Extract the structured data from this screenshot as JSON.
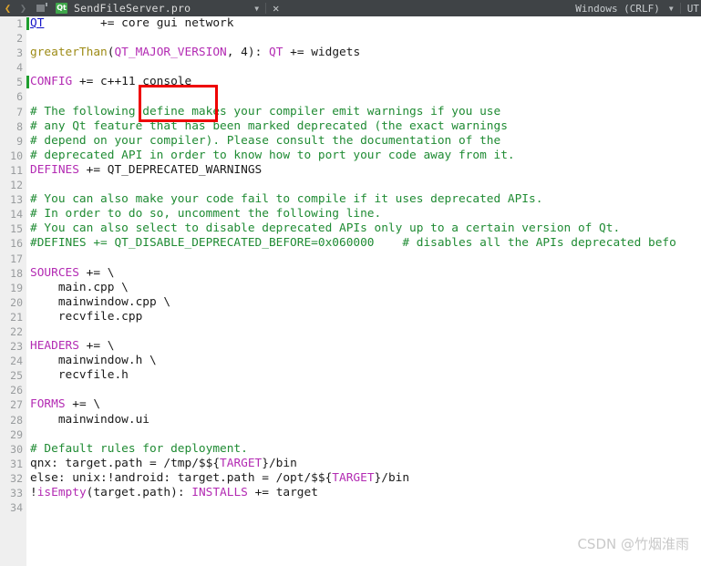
{
  "titlebar": {
    "back_icon": "chevron-left-icon",
    "forward_icon": "chevron-right-icon",
    "split_icon": "split-window-icon",
    "app_icon_label": "Qt",
    "document_title": "SendFileServer.pro",
    "caret_icon": "chevron-down-icon",
    "close_icon": "close-icon",
    "eol_mode": "Windows (CRLF)",
    "eol_caret_icon": "chevron-down-icon",
    "encoding": "UT"
  },
  "editor": {
    "redbox_target": "console",
    "lines": [
      {
        "n": "1",
        "modified": true,
        "tokens": [
          {
            "t": "QT",
            "c": "lnk"
          },
          {
            "t": "        += core gui network",
            "c": "plain"
          }
        ]
      },
      {
        "n": "2",
        "modified": false,
        "tokens": []
      },
      {
        "n": "3",
        "modified": false,
        "tokens": [
          {
            "t": "greaterThan",
            "c": "fn"
          },
          {
            "t": "(",
            "c": "plain"
          },
          {
            "t": "QT_MAJOR_VERSION",
            "c": "var"
          },
          {
            "t": ", 4): ",
            "c": "plain"
          },
          {
            "t": "QT",
            "c": "var"
          },
          {
            "t": " += widgets",
            "c": "plain"
          }
        ]
      },
      {
        "n": "4",
        "modified": false,
        "tokens": []
      },
      {
        "n": "5",
        "modified": true,
        "tokens": [
          {
            "t": "CONFIG",
            "c": "var"
          },
          {
            "t": " += c++11 console",
            "c": "plain"
          }
        ]
      },
      {
        "n": "6",
        "modified": false,
        "tokens": []
      },
      {
        "n": "7",
        "modified": false,
        "tokens": [
          {
            "t": "# The following define makes your compiler emit warnings if you use",
            "c": "cmt"
          }
        ]
      },
      {
        "n": "8",
        "modified": false,
        "tokens": [
          {
            "t": "# any Qt feature that has been marked deprecated (the exact warnings",
            "c": "cmt"
          }
        ]
      },
      {
        "n": "9",
        "modified": false,
        "tokens": [
          {
            "t": "# depend on your compiler). Please consult the documentation of the",
            "c": "cmt"
          }
        ]
      },
      {
        "n": "10",
        "modified": false,
        "tokens": [
          {
            "t": "# deprecated API in order to know how to port your code away from it.",
            "c": "cmt"
          }
        ]
      },
      {
        "n": "11",
        "modified": false,
        "tokens": [
          {
            "t": "DEFINES",
            "c": "var"
          },
          {
            "t": " += QT_DEPRECATED_WARNINGS",
            "c": "plain"
          }
        ]
      },
      {
        "n": "12",
        "modified": false,
        "tokens": []
      },
      {
        "n": "13",
        "modified": false,
        "tokens": [
          {
            "t": "# You can also make your code fail to compile if it uses deprecated APIs.",
            "c": "cmt"
          }
        ]
      },
      {
        "n": "14",
        "modified": false,
        "tokens": [
          {
            "t": "# In order to do so, uncomment the following line.",
            "c": "cmt"
          }
        ]
      },
      {
        "n": "15",
        "modified": false,
        "tokens": [
          {
            "t": "# You can also select to disable deprecated APIs only up to a certain version of Qt.",
            "c": "cmt"
          }
        ]
      },
      {
        "n": "16",
        "modified": false,
        "tokens": [
          {
            "t": "#DEFINES += QT_DISABLE_DEPRECATED_BEFORE=0x060000    # disables all the APIs deprecated befo",
            "c": "cmt"
          }
        ]
      },
      {
        "n": "17",
        "modified": false,
        "tokens": []
      },
      {
        "n": "18",
        "modified": false,
        "tokens": [
          {
            "t": "SOURCES",
            "c": "var"
          },
          {
            "t": " += \\",
            "c": "plain"
          }
        ]
      },
      {
        "n": "19",
        "modified": false,
        "tokens": [
          {
            "t": "    main.cpp \\",
            "c": "plain"
          }
        ]
      },
      {
        "n": "20",
        "modified": false,
        "tokens": [
          {
            "t": "    mainwindow.cpp \\",
            "c": "plain"
          }
        ]
      },
      {
        "n": "21",
        "modified": false,
        "tokens": [
          {
            "t": "    recvfile.cpp",
            "c": "plain"
          }
        ]
      },
      {
        "n": "22",
        "modified": false,
        "tokens": []
      },
      {
        "n": "23",
        "modified": false,
        "tokens": [
          {
            "t": "HEADERS",
            "c": "var"
          },
          {
            "t": " += \\",
            "c": "plain"
          }
        ]
      },
      {
        "n": "24",
        "modified": false,
        "tokens": [
          {
            "t": "    mainwindow.h \\",
            "c": "plain"
          }
        ]
      },
      {
        "n": "25",
        "modified": false,
        "tokens": [
          {
            "t": "    recvfile.h",
            "c": "plain"
          }
        ]
      },
      {
        "n": "26",
        "modified": false,
        "tokens": []
      },
      {
        "n": "27",
        "modified": false,
        "tokens": [
          {
            "t": "FORMS",
            "c": "var"
          },
          {
            "t": " += \\",
            "c": "plain"
          }
        ]
      },
      {
        "n": "28",
        "modified": false,
        "tokens": [
          {
            "t": "    mainwindow.ui",
            "c": "plain"
          }
        ]
      },
      {
        "n": "29",
        "modified": false,
        "tokens": []
      },
      {
        "n": "30",
        "modified": false,
        "tokens": [
          {
            "t": "# Default rules for deployment.",
            "c": "cmt"
          }
        ]
      },
      {
        "n": "31",
        "modified": false,
        "tokens": [
          {
            "t": "qnx: target.path = /tmp/$${",
            "c": "plain"
          },
          {
            "t": "TARGET",
            "c": "var"
          },
          {
            "t": "}/bin",
            "c": "plain"
          }
        ]
      },
      {
        "n": "32",
        "modified": false,
        "tokens": [
          {
            "t": "else: unix:!android: target.path = /opt/$${",
            "c": "plain"
          },
          {
            "t": "TARGET",
            "c": "var"
          },
          {
            "t": "}/bin",
            "c": "plain"
          }
        ]
      },
      {
        "n": "33",
        "modified": false,
        "tokens": [
          {
            "t": "!",
            "c": "plain"
          },
          {
            "t": "isEmpty",
            "c": "var"
          },
          {
            "t": "(target.path): ",
            "c": "plain"
          },
          {
            "t": "INSTALLS",
            "c": "var"
          },
          {
            "t": " += target",
            "c": "plain"
          }
        ]
      },
      {
        "n": "34",
        "modified": false,
        "tokens": []
      }
    ]
  },
  "watermark": {
    "text": "CSDN @竹烟淮雨"
  },
  "colors": {
    "titlebar_bg": "#3f4346",
    "gutter_bg": "#efefef",
    "comment": "#1f8b33",
    "variable": "#b32bb3",
    "function": "#9d8b16",
    "link": "#1414c8",
    "modified_marker": "#1f9e2f",
    "highlight_box": "#ee0000"
  }
}
